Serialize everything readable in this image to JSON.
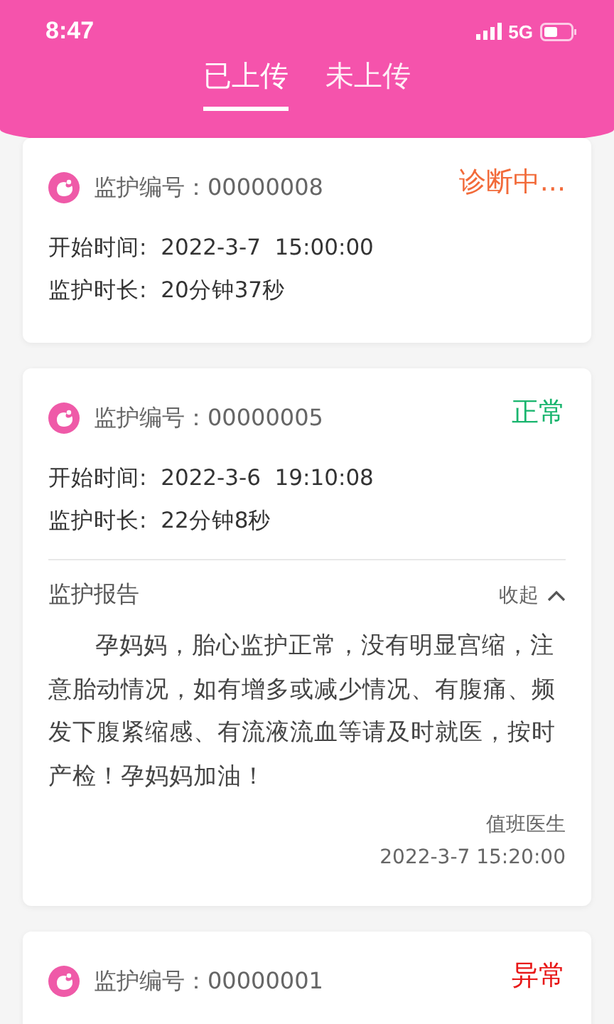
{
  "status_bar": {
    "time": "8:47",
    "network": "5G"
  },
  "tabs": [
    {
      "label": "已上传",
      "selected": true
    },
    {
      "label": "未上传",
      "selected": false
    }
  ],
  "records": [
    {
      "id_label": "监护编号：",
      "id": "00000008",
      "status": "诊断中...",
      "kind": "diagnosing",
      "fields": [
        {
          "label": "开始时间:",
          "value": "2022-3-7  15:00:00"
        },
        {
          "label": "监护时长:",
          "value": "20分钟37秒"
        }
      ]
    },
    {
      "id_label": "监护编号：",
      "id": "00000005",
      "status": "正常",
      "kind": "normal",
      "fields": [
        {
          "label": "开始时间:",
          "value": "2022-3-6  19:10:08"
        },
        {
          "label": "监护时长:",
          "value": "22分钟8秒"
        }
      ],
      "report": {
        "title": "监护报告",
        "toggle": "收起",
        "expanded": true,
        "text": "孕妈妈，胎心监护正常，没有明显宫缩，注意胎动情况，如有增多或减少情况、有腹痛、频发下腹紧缩感、有流液流血等请及时就医，按时产检！孕妈妈加油！",
        "doctor": "值班医生",
        "time": "2022-3-7  15:20:00"
      }
    },
    {
      "id_label": "监护编号：",
      "id": "00000001",
      "status": "异常",
      "kind": "abnormal"
    }
  ]
}
